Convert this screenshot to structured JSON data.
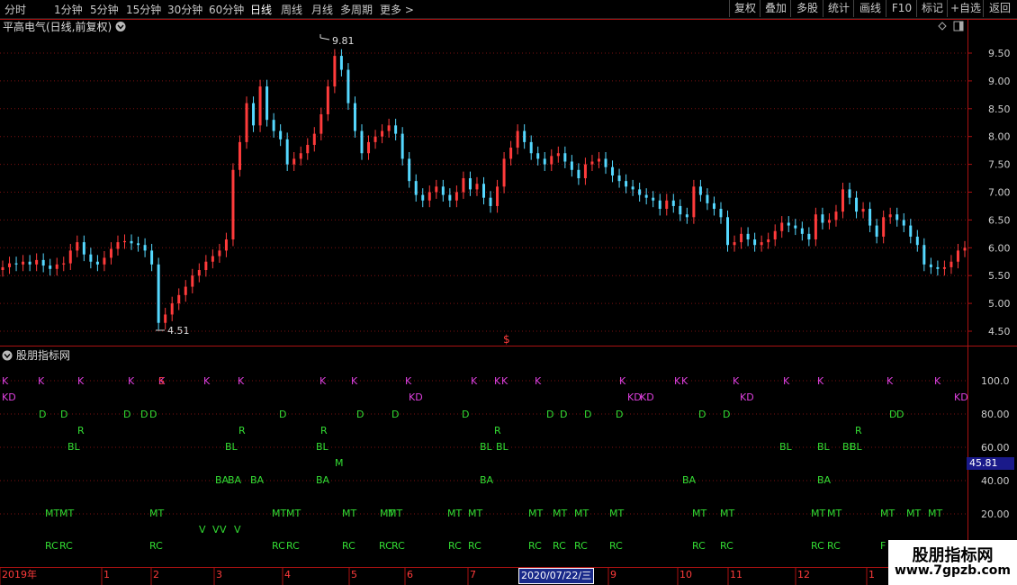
{
  "toolbar": {
    "period_tabs": [
      "分时",
      "1分钟",
      "5分钟",
      "15分钟",
      "30分钟",
      "60分钟",
      "日线",
      "周线",
      "月线",
      "多周期",
      "更多 >"
    ],
    "active_tab": "日线",
    "right_buttons": [
      "复权",
      "叠加",
      "多股",
      "统计",
      "画线",
      "F10",
      "标记",
      "+自选",
      "返回"
    ]
  },
  "chart_header": {
    "title": "平高电气(日线,前复权)"
  },
  "price_axis": [
    "9.50",
    "9.00",
    "8.50",
    "8.00",
    "7.50",
    "7.00",
    "6.50",
    "6.00",
    "5.50",
    "5.00",
    "4.50"
  ],
  "annotations": {
    "high": "9.81",
    "low": "4.51",
    "marker": "$"
  },
  "indicator": {
    "title": "股朋指标网",
    "axis": [
      "100.0",
      "80.00",
      "60.00",
      "40.00",
      "20.00"
    ],
    "current_value": "45.81"
  },
  "time_axis": [
    "2019年",
    "1",
    "2",
    "3",
    "4",
    "5",
    "6",
    "7",
    "9",
    "10",
    "11",
    "12",
    "1"
  ],
  "date_box": "2020/07/22/三",
  "watermark": {
    "title": "股朋指标网",
    "url": "www.7gpzb.com"
  },
  "colors": {
    "up": "#ff3b3b",
    "down": "#55d8ff",
    "grid": "#7a1010",
    "magenta": "#e040e0",
    "green": "#33dd33",
    "frame": "#aa1111"
  },
  "chart_data": {
    "type": "candlestick",
    "y_range": [
      4.4,
      9.9
    ],
    "x_range": [
      0,
      141
    ],
    "close": [
      5.65,
      5.72,
      5.7,
      5.75,
      5.7,
      5.78,
      5.68,
      5.62,
      5.7,
      5.72,
      5.95,
      6.1,
      5.88,
      5.75,
      5.7,
      5.82,
      5.98,
      6.1,
      6.12,
      6.08,
      6.05,
      5.95,
      5.7,
      4.65,
      4.8,
      5.0,
      5.15,
      5.3,
      5.5,
      5.6,
      5.75,
      5.85,
      5.95,
      6.15,
      7.4,
      7.9,
      8.6,
      8.2,
      8.9,
      8.3,
      8.1,
      7.95,
      7.5,
      7.6,
      7.7,
      7.85,
      8.05,
      8.4,
      8.9,
      9.45,
      9.2,
      8.6,
      8.1,
      7.7,
      7.9,
      8.0,
      8.1,
      8.2,
      8.05,
      7.6,
      7.2,
      6.95,
      6.85,
      7.0,
      7.1,
      6.95,
      6.85,
      7.0,
      7.25,
      7.05,
      7.15,
      6.9,
      6.75,
      7.1,
      7.6,
      7.8,
      8.1,
      7.9,
      7.7,
      7.6,
      7.5,
      7.65,
      7.7,
      7.55,
      7.4,
      7.25,
      7.5,
      7.55,
      7.6,
      7.45,
      7.3,
      7.2,
      7.1,
      7.05,
      6.95,
      6.9,
      6.85,
      6.7,
      6.85,
      6.75,
      6.6,
      6.55,
      7.1,
      6.95,
      6.8,
      6.7,
      6.55,
      6.05,
      6.1,
      6.25,
      6.15,
      6.05,
      6.1,
      6.15,
      6.3,
      6.45,
      6.4,
      6.35,
      6.25,
      6.15,
      6.6,
      6.45,
      6.5,
      6.65,
      7.05,
      6.9,
      6.65,
      6.7,
      6.4,
      6.2,
      6.55,
      6.6,
      6.5,
      6.4,
      6.2,
      6.05,
      5.7,
      5.65,
      5.62,
      5.65,
      5.75,
      5.95,
      6.0
    ]
  }
}
